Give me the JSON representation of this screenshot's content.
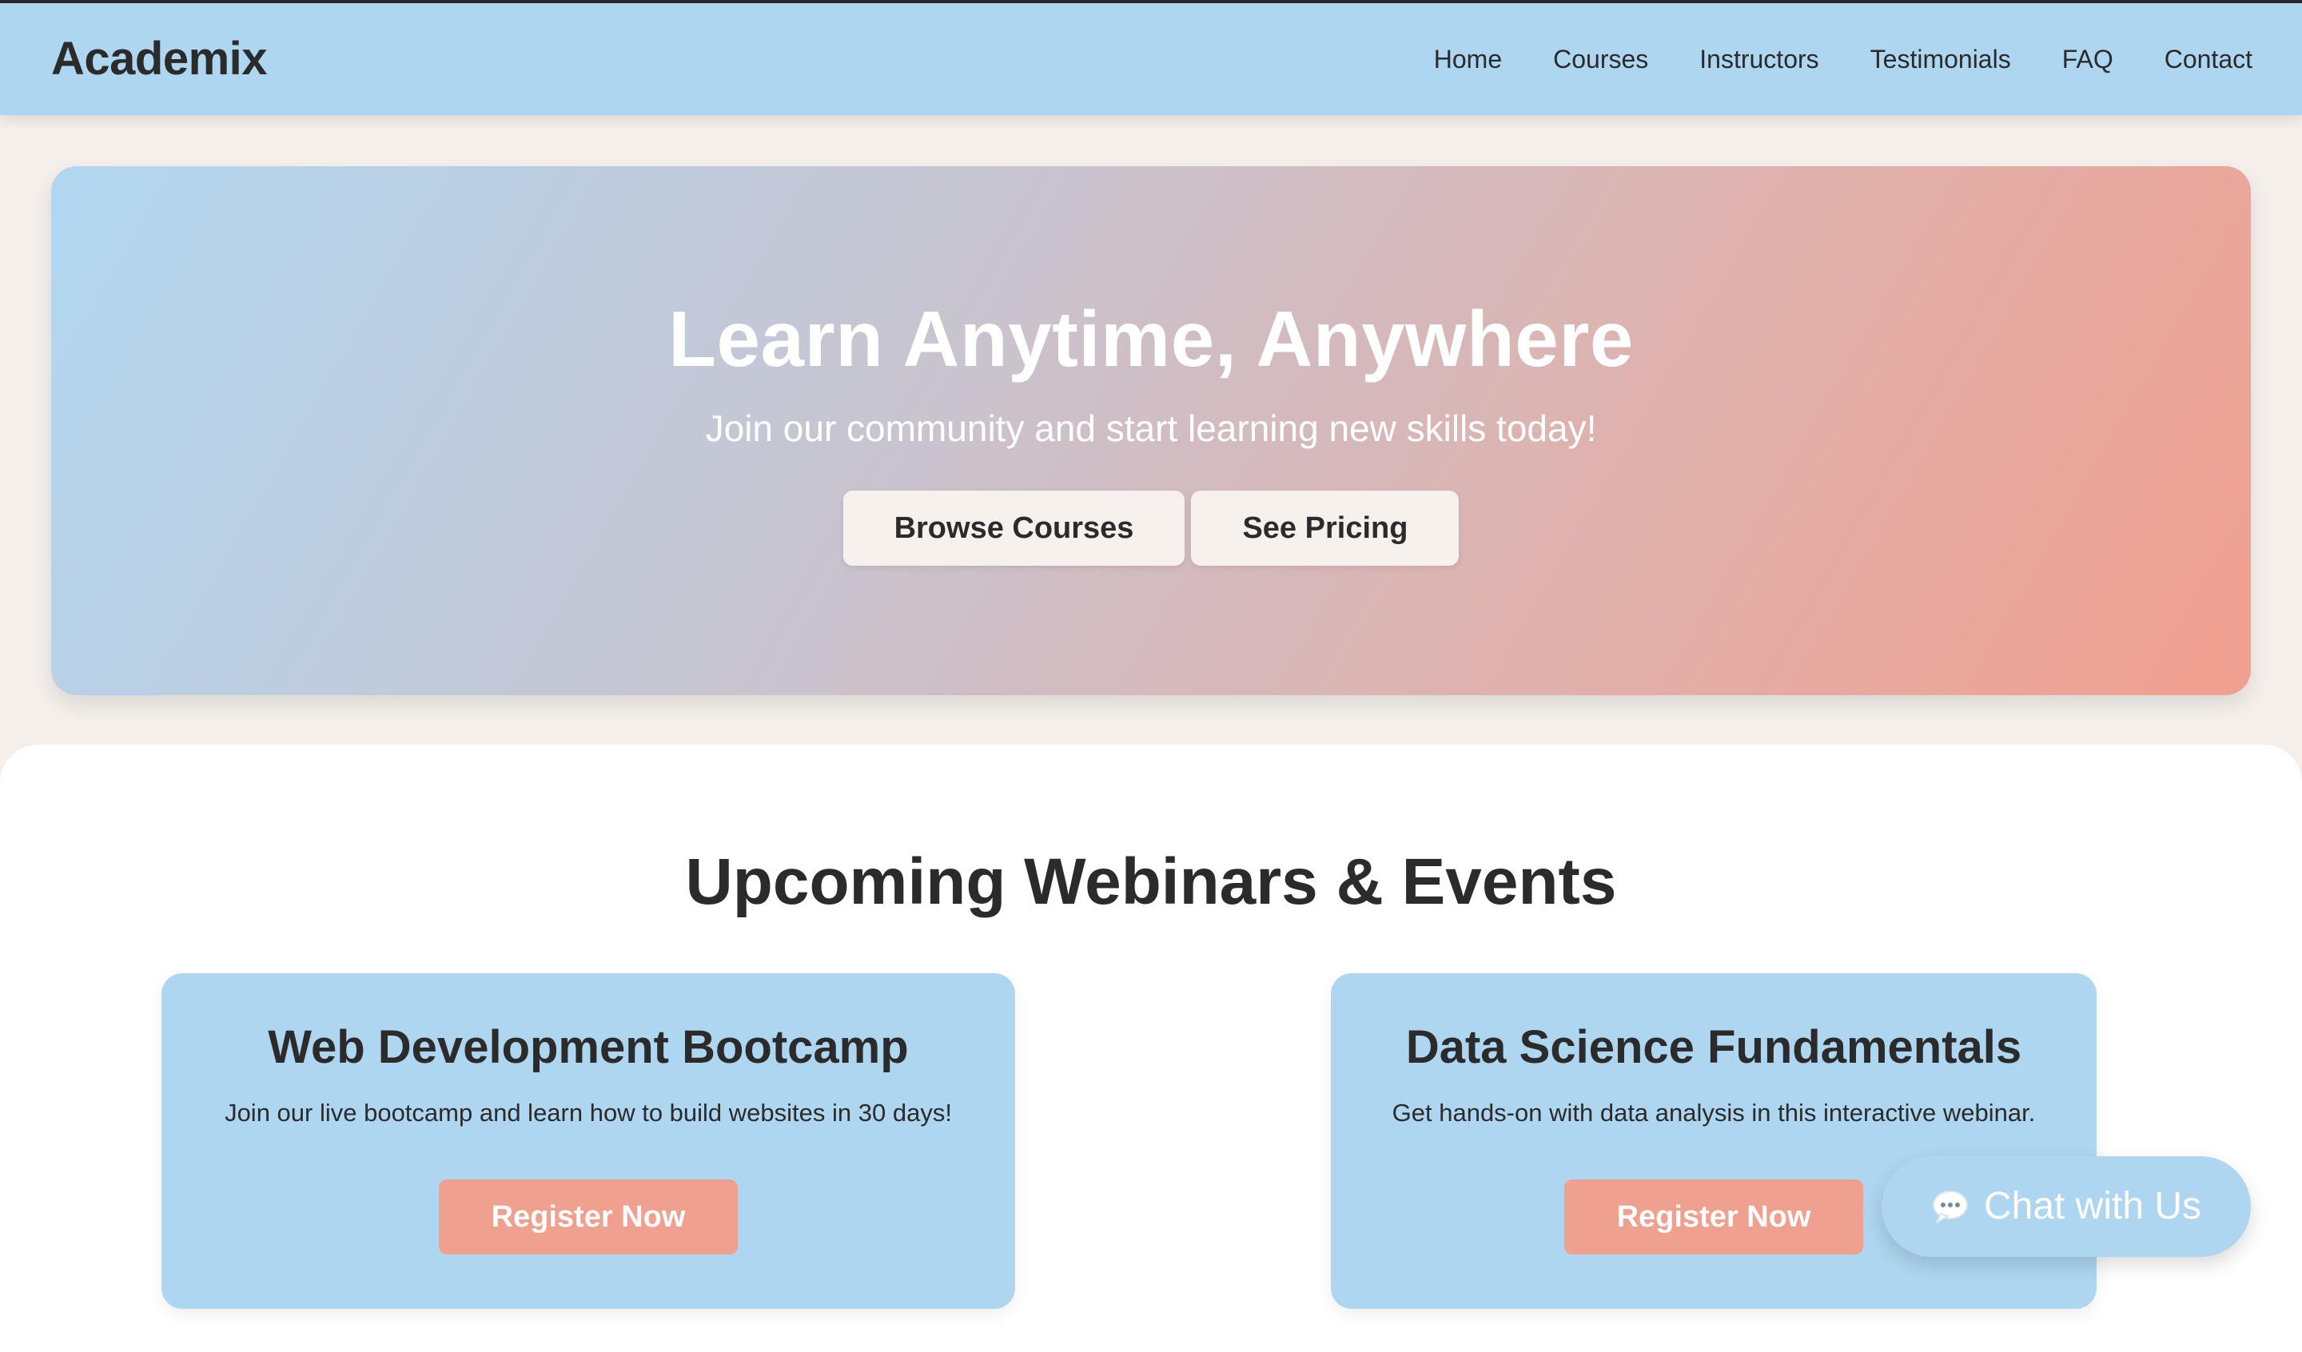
{
  "nav": {
    "brand": "Academix",
    "links": [
      {
        "label": "Home"
      },
      {
        "label": "Courses"
      },
      {
        "label": "Instructors"
      },
      {
        "label": "Testimonials"
      },
      {
        "label": "FAQ"
      },
      {
        "label": "Contact"
      }
    ]
  },
  "hero": {
    "title": "Learn Anytime, Anywhere",
    "subtitle": "Join our community and start learning new skills today!",
    "primary_button": "Browse Courses",
    "secondary_button": "See Pricing"
  },
  "events": {
    "title": "Upcoming Webinars & Events",
    "cards": [
      {
        "title": "Web Development Bootcamp",
        "description": "Join our live bootcamp and learn how to build websites in 30 days!",
        "button": "Register Now"
      },
      {
        "title": "Data Science Fundamentals",
        "description": "Get hands-on with data analysis in this interactive webinar.",
        "button": "Register Now"
      }
    ]
  },
  "chat": {
    "label": "Chat with Us",
    "icon": "chat-bubble-icon"
  },
  "colors": {
    "nav_background": "#aed6f0",
    "page_background": "#f4efea",
    "accent": "#f0a08f",
    "button_light": "#f6f1ec",
    "text": "#2b2b2b"
  }
}
